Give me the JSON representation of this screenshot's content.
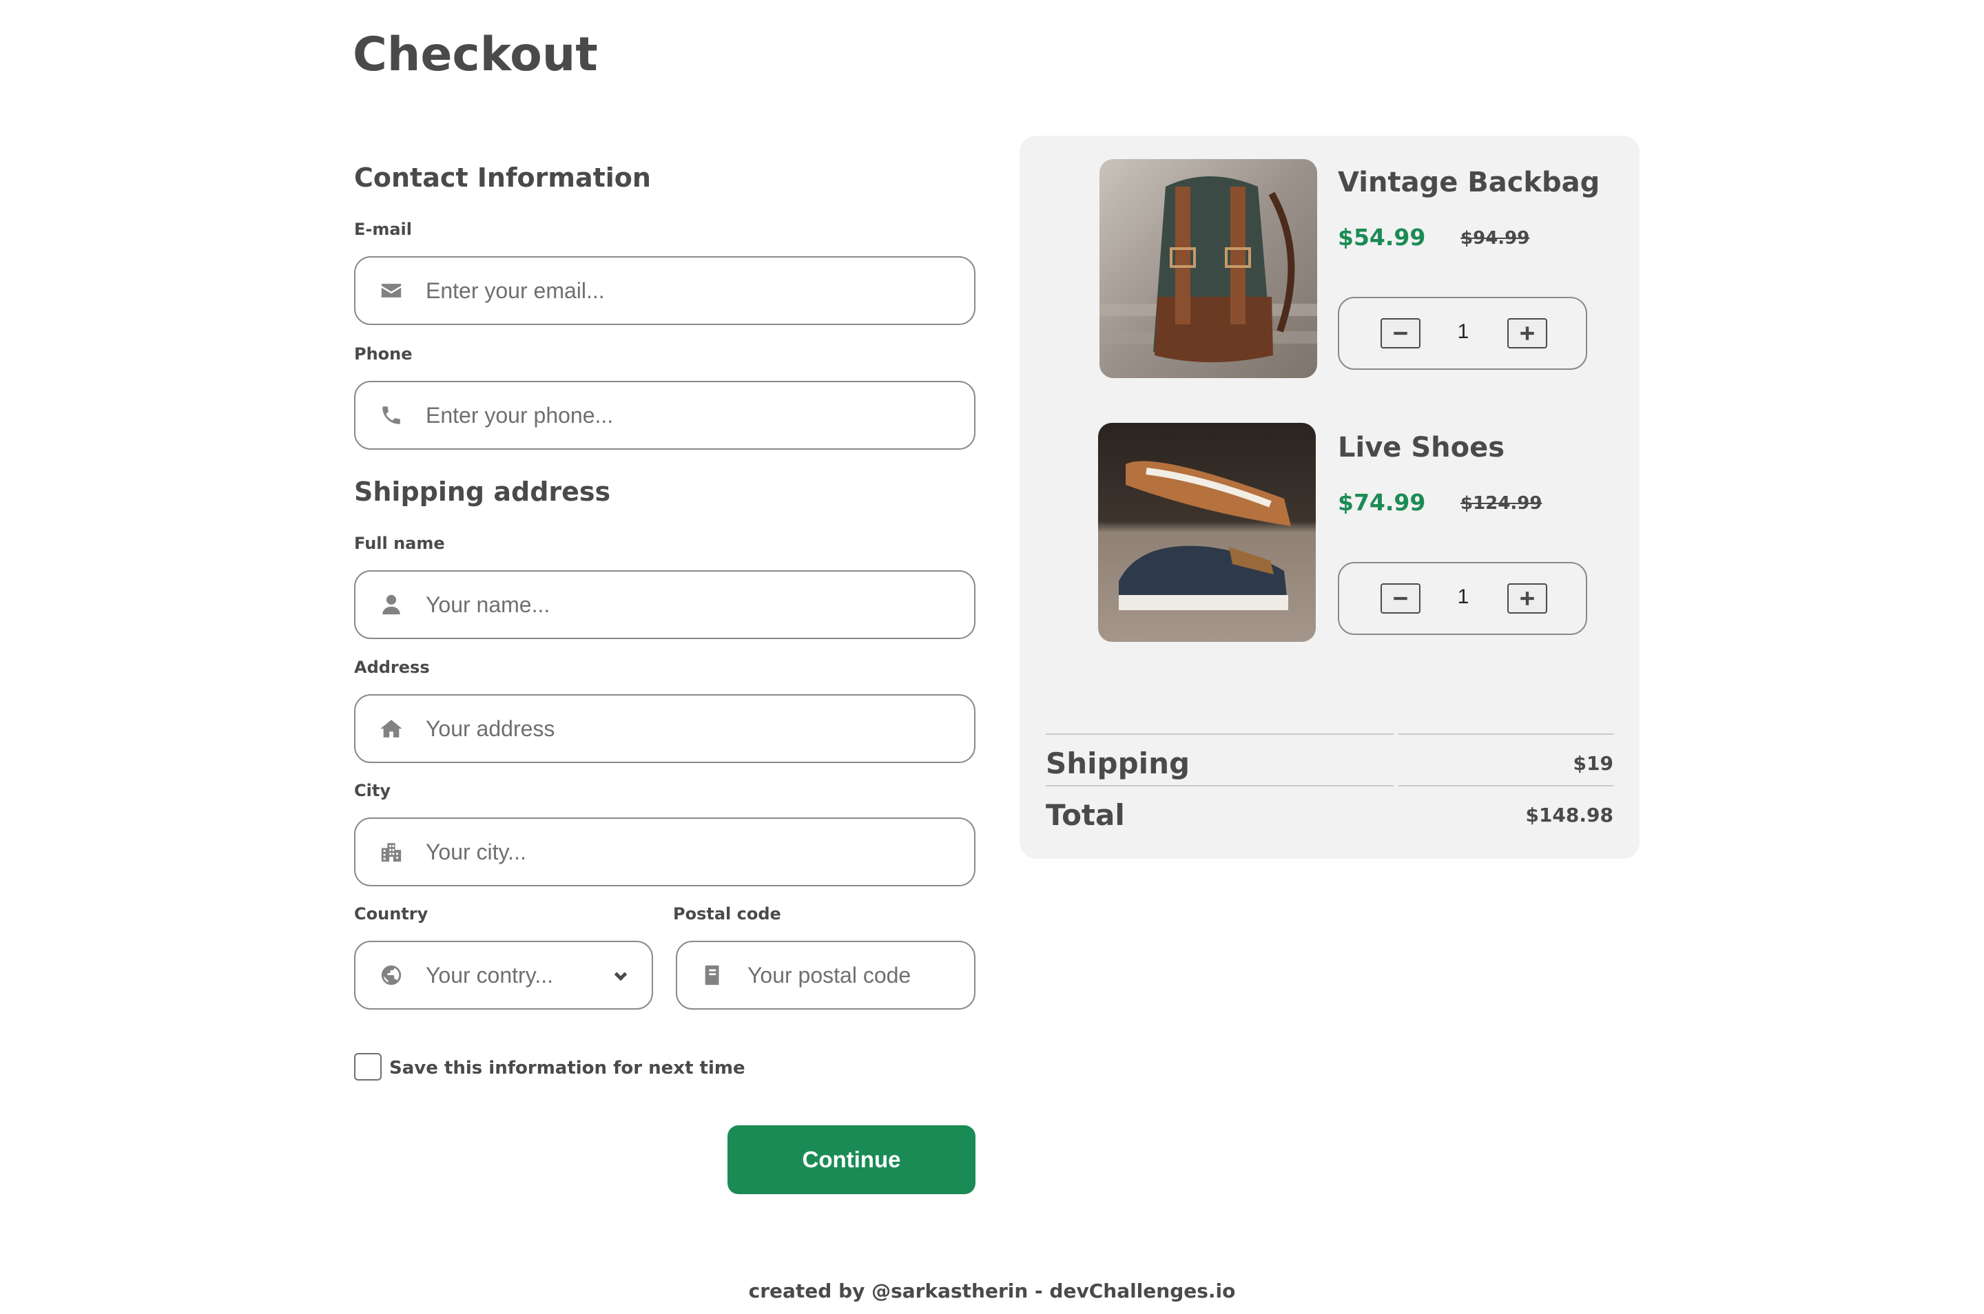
{
  "page": {
    "title": "Checkout"
  },
  "contact": {
    "heading": "Contact Information",
    "email_label": "E-mail",
    "email_placeholder": "Enter your email...",
    "phone_label": "Phone",
    "phone_placeholder": "Enter your phone..."
  },
  "shipping": {
    "heading": "Shipping address",
    "name_label": "Full name",
    "name_placeholder": "Your name...",
    "address_label": "Address",
    "address_placeholder": "Your address",
    "city_label": "City",
    "city_placeholder": "Your city...",
    "country_label": "Country",
    "country_placeholder": "Your contry...",
    "postal_label": "Postal code",
    "postal_placeholder": "Your postal code"
  },
  "save_info": {
    "label": "Save this information for next time",
    "checked": false
  },
  "continue_label": "Continue",
  "cart": {
    "items": [
      {
        "name": "Vintage Backbag",
        "price": "$54.99",
        "old_price": "$94.99",
        "quantity": "1"
      },
      {
        "name": "Live Shoes",
        "price": "$74.99",
        "old_price": "$124.99",
        "quantity": "1"
      }
    ],
    "shipping_label": "Shipping",
    "shipping_value": "$19",
    "total_label": "Total",
    "total_value": "$148.98"
  },
  "footer": "created by @sarkastherin - devChallenges.io",
  "colors": {
    "accent": "#1b8b55",
    "cart_bg": "#f2f2f2",
    "text": "#4a4a4a"
  },
  "icons": [
    "envelope-icon",
    "phone-icon",
    "user-icon",
    "home-icon",
    "city-icon",
    "globe-icon",
    "chevron-down-icon",
    "book-icon",
    "minus-icon",
    "plus-icon"
  ]
}
